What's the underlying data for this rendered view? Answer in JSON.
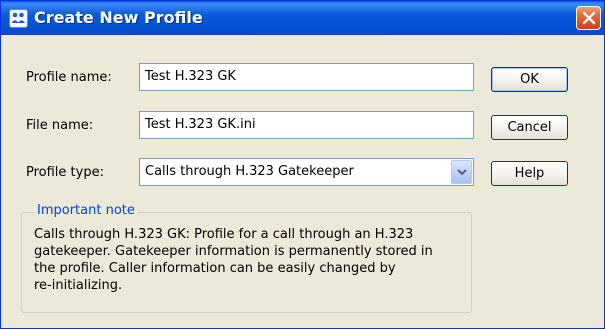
{
  "window": {
    "title": "Create New Profile",
    "icon": "profile-app-icon",
    "close_icon": "close-icon",
    "accent_color": "#0054e3",
    "close_color": "#e4653a"
  },
  "form": {
    "profile_name_label": "Profile name:",
    "profile_name_value": "Test H.323 GK",
    "file_name_label": "File name:",
    "file_name_value": "Test H.323 GK.ini",
    "profile_type_label": "Profile type:",
    "profile_type_value": "Calls through H.323 Gatekeeper",
    "dropdown_icon": "chevron-down-icon"
  },
  "buttons": {
    "ok_label": "OK",
    "cancel_label": "Cancel",
    "help_label": "Help"
  },
  "note": {
    "legend": "Important note",
    "lines": [
      "Calls through H.323 GK: Profile for a call through an H.323",
      "gatekeeper. Gatekeeper information is permanently stored in",
      "the profile. Caller information can be easily changed by",
      "re-initializing."
    ],
    "legend_color": "#0046d5"
  }
}
